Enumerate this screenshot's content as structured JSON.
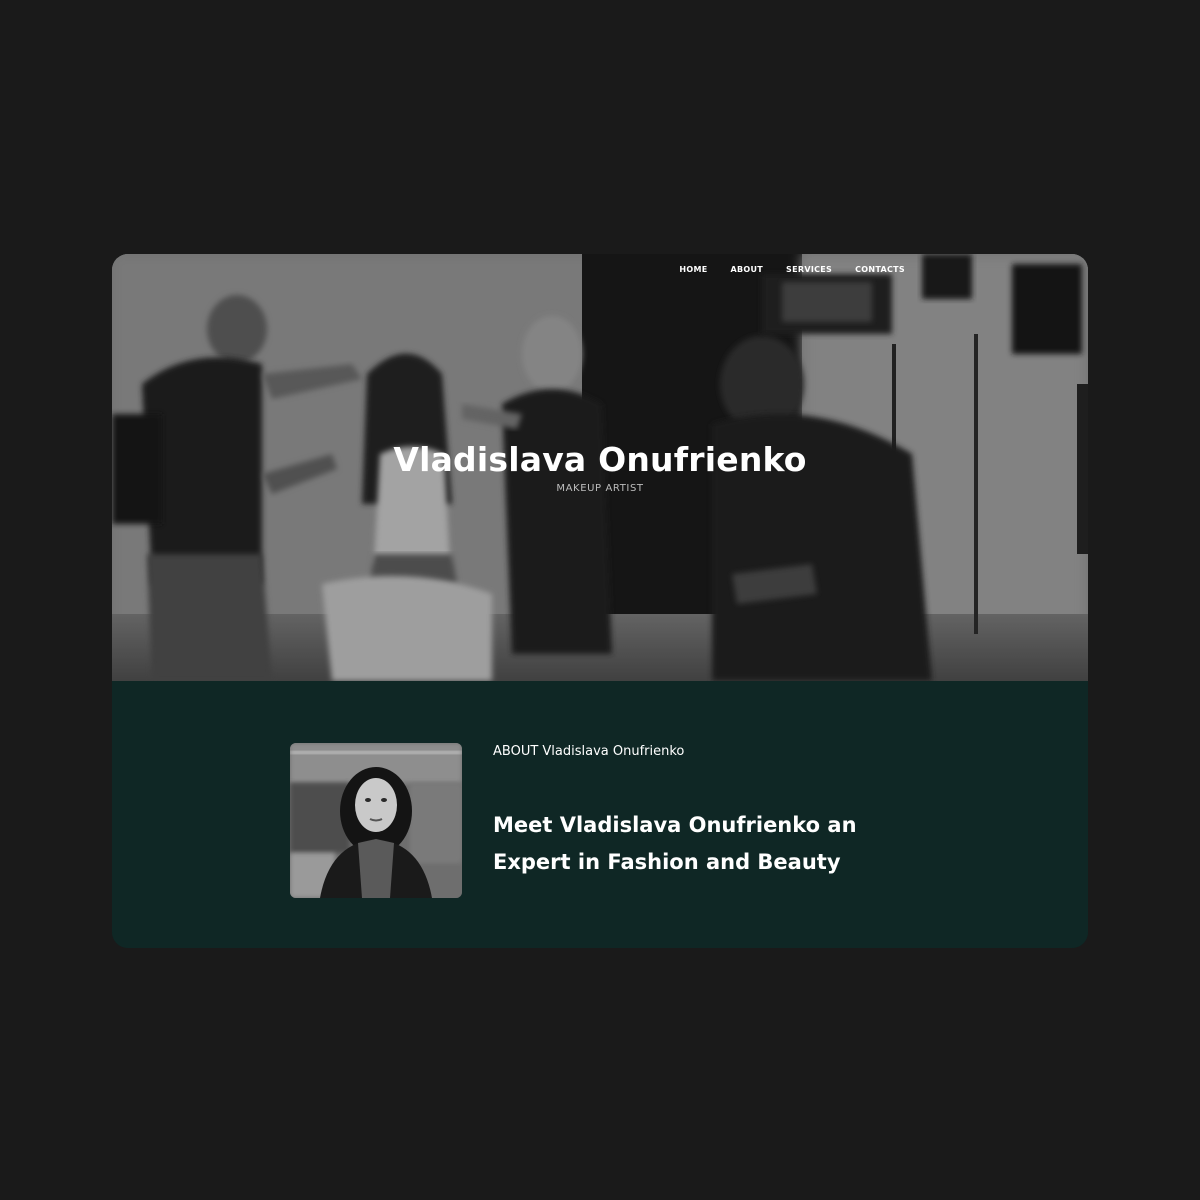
{
  "nav": {
    "items": [
      {
        "label": "HOME"
      },
      {
        "label": "ABOUT"
      },
      {
        "label": "SERVICES"
      },
      {
        "label": "CONTACTS"
      }
    ]
  },
  "hero": {
    "title": "Vladislava Onufrienko",
    "subtitle": "MAKEUP ARTIST"
  },
  "about": {
    "label": "ABOUT Vladislava Onufrienko",
    "heading": "Meet Vladislava Onufrienko an Expert in Fashion and Beauty"
  },
  "colors": {
    "page_background": "#1a1a1a",
    "about_background": "#0f2725",
    "text_primary": "#ffffff",
    "text_muted": "#bdbdbd"
  }
}
